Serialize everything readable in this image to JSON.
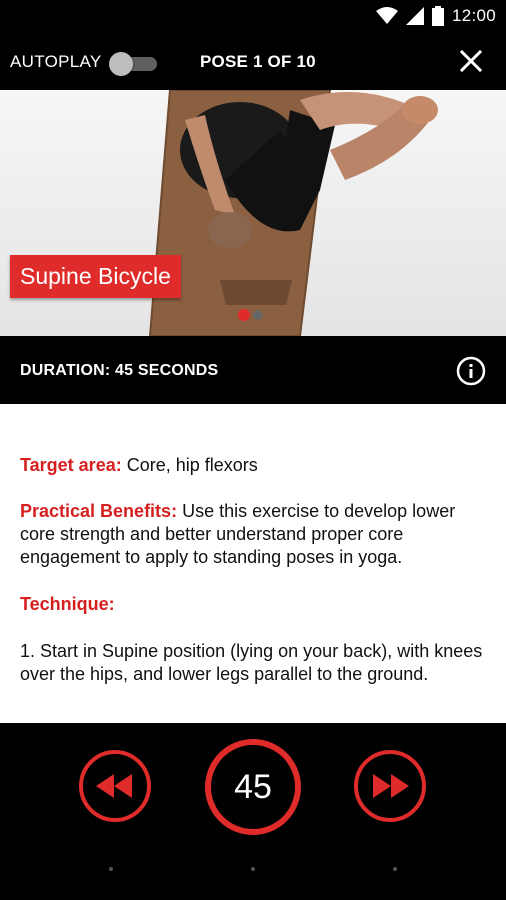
{
  "status_bar": {
    "time": "12:00",
    "icons": [
      "wifi-icon",
      "signal-icon",
      "battery-icon"
    ]
  },
  "top_bar": {
    "autoplay_label": "AUTOPLAY",
    "autoplay_on": false,
    "pose_counter": "POSE 1 OF 10",
    "close_icon": "close-icon"
  },
  "hero": {
    "pose_name": "Supine Bicycle",
    "image_description_icon": "pose-photo"
  },
  "duration": {
    "text": "DURATION: 45 SECONDS",
    "info_icon": "info-icon"
  },
  "details": {
    "target_label": "Target area:",
    "target_value": " Core, hip flexors",
    "benefits_label": "Practical Benefits:",
    "benefits_value": " Use this exercise to develop lower core strength and better understand proper core engagement to apply to standing poses in yoga.",
    "technique_label": "Technique:",
    "technique_step1": "1. Start in Supine position (lying on your back), with knees over the hips, and lower legs parallel to the ground."
  },
  "controls": {
    "timer_value": "45",
    "rewind_icon": "rewind-icon",
    "fast_forward_icon": "fast-forward-icon"
  },
  "colors": {
    "accent": "#e02b2b",
    "label_red": "#d62020",
    "background": "#000000"
  }
}
